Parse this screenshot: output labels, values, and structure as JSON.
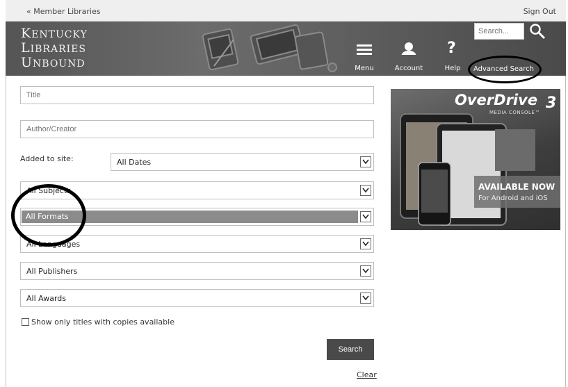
{
  "topbar": {
    "member_libraries": "« Member Libraries",
    "sign_out": "Sign Out"
  },
  "header": {
    "logo_lines": [
      {
        "cap": "K",
        "rest": "ENTUCKY"
      },
      {
        "cap": "L",
        "rest": "IBRARIES"
      },
      {
        "cap": "U",
        "rest": "NBOUND"
      }
    ],
    "nav": {
      "menu": "Menu",
      "account": "Account",
      "help": "Help"
    },
    "search_placeholder": "Search...",
    "advanced_search": "Advanced Search"
  },
  "form": {
    "title_placeholder": "Title",
    "author_placeholder": "Author/Creator",
    "added_label": "Added to site:",
    "added_value": "All Dates",
    "subjects_value": "All Subjects",
    "formats_value": "All Formats",
    "languages_value": "All Languages",
    "publishers_value": "All Publishers",
    "awards_value": "All Awards",
    "copies_checkbox": "Show only titles with copies available",
    "copies_checked": false,
    "search_button": "Search",
    "clear_link": "Clear"
  },
  "ad": {
    "brand": "OverDrive",
    "version": "3",
    "subtitle": "MEDIA CONSOLE™",
    "available": "AVAILABLE NOW",
    "platforms": "For Android and iOS"
  },
  "colors": {
    "banner": "#5f5f5f",
    "button": "#4a4a4a",
    "highlight": "#8b8b8b",
    "annotation": "#000000"
  }
}
